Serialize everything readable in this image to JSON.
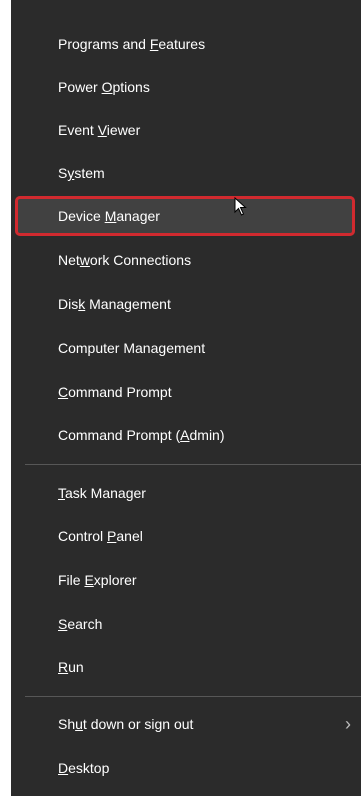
{
  "menu": {
    "items": [
      {
        "pre": "Programs and ",
        "mn": "F",
        "post": "eatures"
      },
      {
        "pre": "Power ",
        "mn": "O",
        "post": "ptions"
      },
      {
        "pre": "Event ",
        "mn": "V",
        "post": "iewer"
      },
      {
        "pre": "S",
        "mn": "y",
        "post": "stem"
      },
      {
        "pre": "Device ",
        "mn": "M",
        "post": "anager"
      },
      {
        "pre": "Net",
        "mn": "w",
        "post": "ork Connections"
      },
      {
        "pre": "Dis",
        "mn": "k",
        "post": " Management"
      },
      {
        "pre": "Computer Mana",
        "mn": "g",
        "post": "ement"
      },
      {
        "pre": "",
        "mn": "C",
        "post": "ommand Prompt"
      },
      {
        "pre": "Command Prompt (",
        "mn": "A",
        "post": "dmin)"
      },
      {
        "pre": "",
        "mn": "T",
        "post": "ask Manager"
      },
      {
        "pre": "Control ",
        "mn": "P",
        "post": "anel"
      },
      {
        "pre": "File ",
        "mn": "E",
        "post": "xplorer"
      },
      {
        "pre": "",
        "mn": "S",
        "post": "earch"
      },
      {
        "pre": "",
        "mn": "R",
        "post": "un"
      },
      {
        "pre": "Sh",
        "mn": "u",
        "post": "t down or sign out",
        "chevron": "›"
      },
      {
        "pre": "",
        "mn": "D",
        "post": "esktop"
      }
    ]
  },
  "colors": {
    "menu_bg": "#2b2b2b",
    "highlight_border": "#d12a2f",
    "highlight_bg": "#414141"
  },
  "icons": {
    "cursor": "mouse-pointer-icon",
    "submenu": "chevron-right-icon"
  }
}
